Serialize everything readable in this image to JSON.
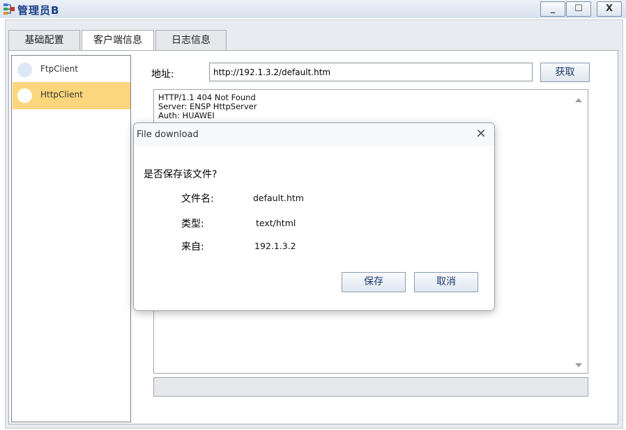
{
  "window": {
    "title": "管理员B",
    "icon": "network-tree-icon",
    "minimize_label": "_",
    "maximize_label": "☐",
    "close_label": "X"
  },
  "tabs": [
    {
      "label": "基础配置",
      "active": false
    },
    {
      "label": "客户端信息",
      "active": true
    },
    {
      "label": "日志信息",
      "active": false
    }
  ],
  "sidebar": {
    "items": [
      {
        "label": "FtpClient",
        "selected": false
      },
      {
        "label": "HttpClient",
        "selected": true
      }
    ]
  },
  "main": {
    "address_label": "地址:",
    "address_value": "http://192.1.3.2/default.htm",
    "fetch_label": "获取",
    "response_text": "HTTP/1.1 404 Not Found\nServer: ENSP HttpServer\nAuth: HUAWEI"
  },
  "dialog": {
    "title": "File download",
    "close_label": "✕",
    "question": "是否保存该文件?",
    "rows": [
      {
        "label": "文件名:",
        "value": "default.htm"
      },
      {
        "label": "类型:",
        "value": "text/html"
      },
      {
        "label": "来自:",
        "value": "192.1.3.2"
      }
    ],
    "save_label": "保存",
    "cancel_label": "取消"
  },
  "colors": {
    "selection": "#fcd67c",
    "title_text": "#173e87"
  }
}
